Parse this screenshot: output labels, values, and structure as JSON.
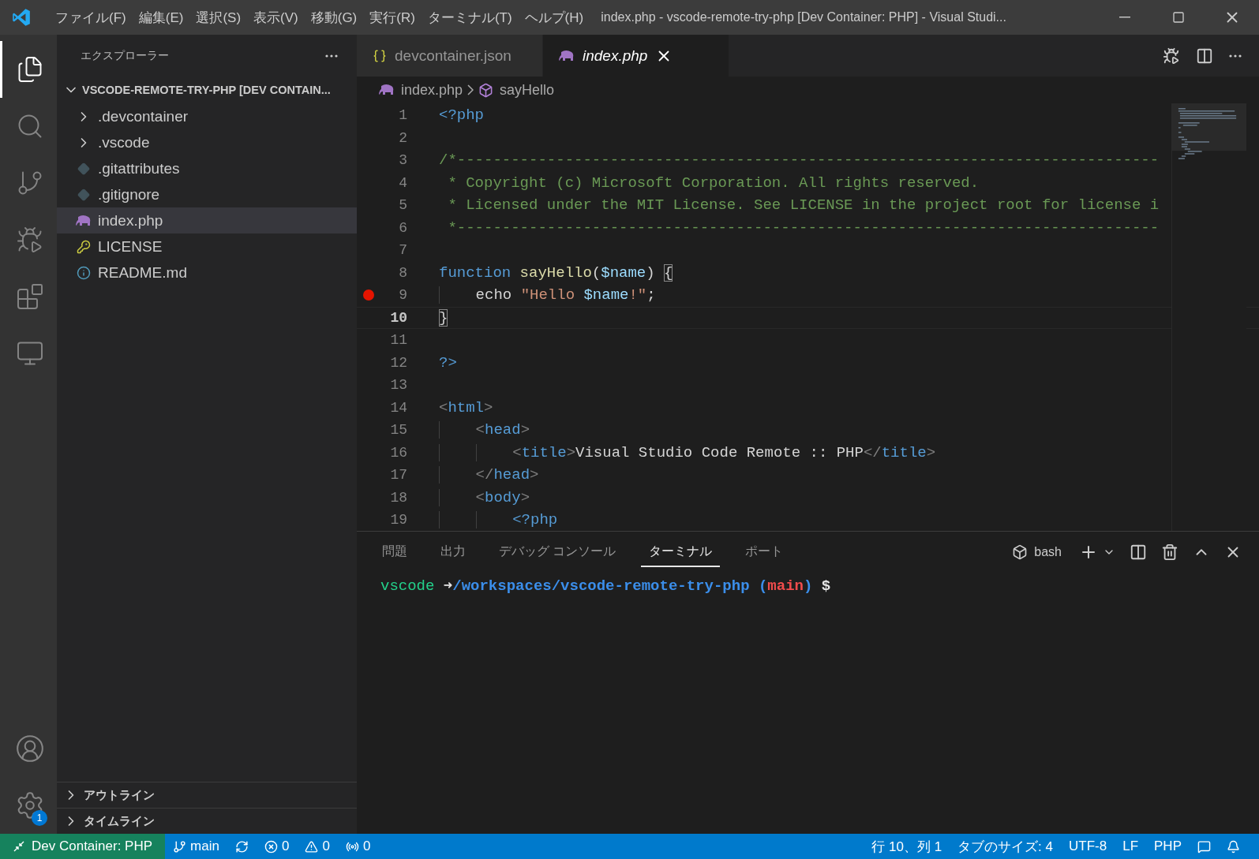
{
  "window": {
    "title": "index.php - vscode-remote-try-php [Dev Container: PHP] - Visual Studi...",
    "menu": [
      "ファイル(F)",
      "編集(E)",
      "選択(S)",
      "表示(V)",
      "移動(G)",
      "実行(R)",
      "ターミナル(T)",
      "ヘルプ(H)"
    ]
  },
  "activity_bar": {
    "items": [
      {
        "kind": "explorer",
        "selected": true
      },
      {
        "kind": "search",
        "selected": false
      },
      {
        "kind": "scm",
        "selected": false
      },
      {
        "kind": "debug",
        "selected": false
      },
      {
        "kind": "extensions",
        "selected": false
      },
      {
        "kind": "remote",
        "selected": false
      }
    ],
    "bottom": [
      {
        "kind": "accounts"
      },
      {
        "kind": "settings",
        "badge": "1"
      }
    ]
  },
  "sidebar": {
    "title": "エクスプローラー",
    "folder": {
      "name": "VSCODE-REMOTE-TRY-PHP [DEV CONTAIN...",
      "expanded": true,
      "children": [
        {
          "name": ".devcontainer",
          "kind": "folder",
          "expanded": false,
          "selected": false
        },
        {
          "name": ".vscode",
          "kind": "folder",
          "expanded": false,
          "selected": false
        },
        {
          "name": ".gitattributes",
          "kind": "git",
          "selected": false
        },
        {
          "name": ".gitignore",
          "kind": "git",
          "selected": false
        },
        {
          "name": "index.php",
          "kind": "php",
          "selected": true
        },
        {
          "name": "LICENSE",
          "kind": "license",
          "selected": false
        },
        {
          "name": "README.md",
          "kind": "info",
          "selected": false
        }
      ]
    },
    "sections": [
      {
        "title": "アウトライン",
        "expanded": false
      },
      {
        "title": "タイムライン",
        "expanded": false
      }
    ]
  },
  "editor": {
    "tabs": [
      {
        "name": "devcontainer.json",
        "kind": "json",
        "selected": false,
        "preview": false
      },
      {
        "name": "index.php",
        "kind": "php",
        "selected": true,
        "preview": true
      }
    ],
    "breadcrumb": [
      {
        "text": "index.php",
        "kind": "php"
      },
      {
        "text": "sayHello",
        "kind": "method"
      }
    ],
    "lines": [
      {
        "number": "1",
        "current": false,
        "tokens": [
          {
            "kind": "keyword",
            "text": "<?php"
          }
        ]
      },
      {
        "number": "2",
        "current": false
      },
      {
        "number": "3",
        "current": false,
        "tokens": [
          {
            "kind": "comment",
            "text": "/*------------------------------------------------------------------------------"
          }
        ]
      },
      {
        "number": "4",
        "current": false,
        "tokens": [
          {
            "kind": "comment",
            "text": " * Copyright (c) Microsoft Corporation. All rights reserved."
          }
        ]
      },
      {
        "number": "5",
        "current": false,
        "tokens": [
          {
            "kind": "comment",
            "text": " * Licensed under the MIT License. See LICENSE in the project root for license i"
          }
        ]
      },
      {
        "number": "6",
        "current": false,
        "tokens": [
          {
            "kind": "comment",
            "text": " *------------------------------------------------------------------------------"
          }
        ]
      },
      {
        "number": "7",
        "current": false
      },
      {
        "number": "8",
        "current": false,
        "tokens": [
          {
            "kind": "keyword",
            "text": "function"
          },
          {
            "kind": "function",
            "text": " sayHello"
          },
          {
            "kind": "plain",
            "text": "("
          },
          {
            "kind": "variable",
            "text": "$name"
          },
          {
            "kind": "plain",
            "text": ") "
          },
          {
            "kind": "bracket",
            "text": "{"
          }
        ]
      },
      {
        "number": "9",
        "breakpoint": true,
        "current": false,
        "tokens": [
          {
            "kind": "plain",
            "text": "    echo "
          },
          {
            "kind": "string",
            "text": "\"Hello "
          },
          {
            "kind": "variable",
            "text": "$name"
          },
          {
            "kind": "string",
            "text": "!\""
          },
          {
            "kind": "plain",
            "text": ";"
          }
        ]
      },
      {
        "number": "10",
        "current": true,
        "tokens": [
          {
            "kind": "bracket",
            "text": "}"
          }
        ]
      },
      {
        "number": "11",
        "current": false
      },
      {
        "number": "12",
        "current": false,
        "tokens": [
          {
            "kind": "keyword",
            "text": "?>"
          }
        ]
      },
      {
        "number": "13",
        "current": false
      },
      {
        "number": "14",
        "current": false,
        "tokens": [
          {
            "kind": "punct",
            "text": "<"
          },
          {
            "kind": "keyword",
            "text": "html"
          },
          {
            "kind": "punct",
            "text": ">"
          }
        ]
      },
      {
        "number": "15",
        "current": false,
        "tokens": [
          {
            "kind": "punct",
            "text": "    <"
          },
          {
            "kind": "keyword",
            "text": "head"
          },
          {
            "kind": "punct",
            "text": ">"
          }
        ]
      },
      {
        "number": "16",
        "current": false,
        "tokens": [
          {
            "kind": "punct",
            "text": "        <"
          },
          {
            "kind": "keyword",
            "text": "title"
          },
          {
            "kind": "punct",
            "text": ">"
          },
          {
            "kind": "plain",
            "text": "Visual Studio Code Remote :: PHP"
          },
          {
            "kind": "punct",
            "text": "</"
          },
          {
            "kind": "keyword",
            "text": "title"
          },
          {
            "kind": "punct",
            "text": ">"
          }
        ]
      },
      {
        "number": "17",
        "current": false,
        "tokens": [
          {
            "kind": "punct",
            "text": "    </"
          },
          {
            "kind": "keyword",
            "text": "head"
          },
          {
            "kind": "punct",
            "text": ">"
          }
        ]
      },
      {
        "number": "18",
        "current": false,
        "tokens": [
          {
            "kind": "punct",
            "text": "    <"
          },
          {
            "kind": "keyword",
            "text": "body"
          },
          {
            "kind": "punct",
            "text": ">"
          }
        ]
      },
      {
        "number": "19",
        "current": false,
        "tokens": [
          {
            "kind": "keyword",
            "text": "        <?php"
          }
        ]
      }
    ]
  },
  "panel": {
    "tabs": [
      {
        "label": "問題",
        "selected": false
      },
      {
        "label": "出力",
        "selected": false
      },
      {
        "label": "デバッグ コンソール",
        "selected": false
      },
      {
        "label": "ターミナル",
        "selected": true
      },
      {
        "label": "ポート",
        "selected": false
      }
    ],
    "shell": "bash",
    "terminal": [
      {
        "kind": "user",
        "text": "vscode"
      },
      {
        "kind": "arrow",
        "text": " ➜"
      },
      {
        "kind": "path",
        "text": "/workspaces/vscode-remote-try-php"
      },
      {
        "kind": "paren",
        "text": " ("
      },
      {
        "kind": "branch",
        "text": "main"
      },
      {
        "kind": "paren",
        "text": ")"
      },
      {
        "kind": "prompt",
        "text": " $"
      }
    ]
  },
  "status_bar": {
    "remote": "Dev Container: PHP",
    "left": [
      {
        "kind": "branch",
        "text": "main"
      },
      {
        "kind": "sync"
      },
      {
        "kind": "errors",
        "text": "0"
      },
      {
        "kind": "warnings",
        "text": "0"
      },
      {
        "kind": "ports",
        "text": "0"
      }
    ],
    "right": [
      {
        "kind": "text",
        "text": "行 10、列 1"
      },
      {
        "kind": "text",
        "text": "タブのサイズ: 4"
      },
      {
        "kind": "text",
        "text": "UTF-8"
      },
      {
        "kind": "text",
        "text": "LF"
      },
      {
        "kind": "text",
        "text": "PHP"
      },
      {
        "kind": "feedback"
      },
      {
        "kind": "bell"
      }
    ]
  }
}
